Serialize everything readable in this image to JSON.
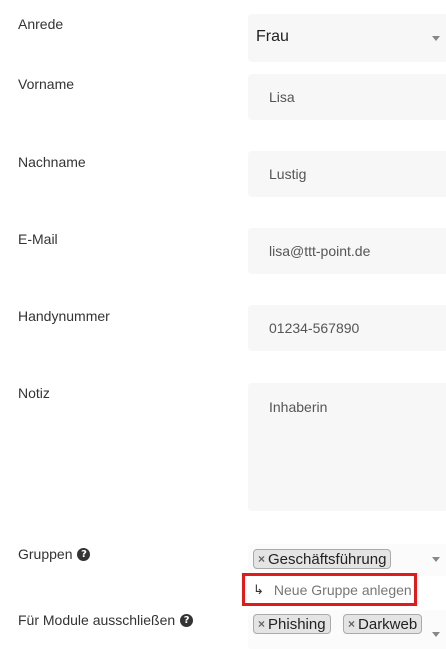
{
  "form": {
    "salutation": {
      "label": "Anrede",
      "value": "Frau"
    },
    "first_name": {
      "label": "Vorname",
      "value": "Lisa"
    },
    "last_name": {
      "label": "Nachname",
      "value": "Lustig"
    },
    "email": {
      "label": "E-Mail",
      "value": "lisa@ttt-point.de"
    },
    "mobile": {
      "label": "Handynummer",
      "value": "01234-567890"
    },
    "note": {
      "label": "Notiz",
      "value": "Inhaberin"
    },
    "groups": {
      "label": "Gruppen",
      "help_icon": "question-circle-icon",
      "tags": [
        "Geschäftsführung"
      ],
      "new_group_link": "Neue Gruppe anlegen",
      "new_group_icon": "arrow-return-icon"
    },
    "exclude_modules": {
      "label": "Für Module ausschließen",
      "help_icon": "question-circle-icon",
      "tags": [
        "Phishing",
        "Darkweb"
      ]
    }
  },
  "colors": {
    "field_bg": "#f8f7f7",
    "highlight_border": "#e01b1b",
    "tag_bg": "#e4e4e4"
  }
}
